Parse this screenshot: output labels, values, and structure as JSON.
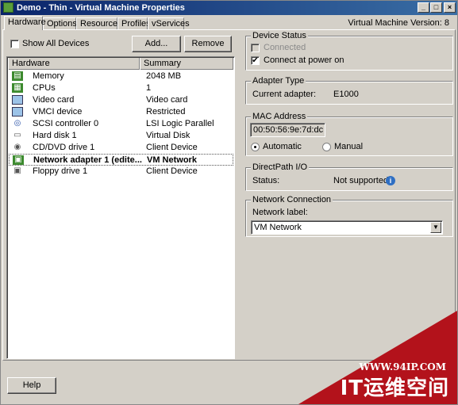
{
  "window": {
    "title": "Demo - Thin - Virtual Machine Properties",
    "vm_version": "Virtual Machine Version: 8",
    "controls": {
      "minimize": "_",
      "maximize": "□",
      "close": "×"
    }
  },
  "tabs": [
    {
      "label": "Hardware"
    },
    {
      "label": "Options"
    },
    {
      "label": "Resources"
    },
    {
      "label": "Profiles"
    },
    {
      "label": "vServices"
    }
  ],
  "hardware": {
    "show_all_devices_label": "Show All Devices",
    "add_button": "Add...",
    "remove_button": "Remove",
    "columns": {
      "hardware": "Hardware",
      "summary": "Summary"
    },
    "rows": [
      {
        "name": "Memory",
        "summary": "2048 MB",
        "icon": "memory-icon"
      },
      {
        "name": "CPUs",
        "summary": "1",
        "icon": "cpu-icon"
      },
      {
        "name": "Video card",
        "summary": "Video card",
        "icon": "video-card-icon"
      },
      {
        "name": "VMCI device",
        "summary": "Restricted",
        "icon": "vmci-icon"
      },
      {
        "name": "SCSI controller 0",
        "summary": "LSI Logic Parallel",
        "icon": "scsi-icon"
      },
      {
        "name": "Hard disk 1",
        "summary": "Virtual Disk",
        "icon": "hard-disk-icon"
      },
      {
        "name": "CD/DVD drive 1",
        "summary": "Client Device",
        "icon": "cd-dvd-icon"
      },
      {
        "name": "Network adapter 1 (edite...",
        "summary": "VM Network",
        "icon": "network-adapter-icon",
        "selected": true
      },
      {
        "name": "Floppy drive 1",
        "summary": "Client Device",
        "icon": "floppy-icon"
      }
    ]
  },
  "device_status": {
    "title": "Device Status",
    "connected_label": "Connected",
    "connect_at_power_on_label": "Connect at power on",
    "connect_at_power_on_checked": "✔"
  },
  "adapter_type": {
    "title": "Adapter Type",
    "current_label": "Current adapter:",
    "current_value": "E1000"
  },
  "mac_address": {
    "title": "MAC Address",
    "value": "00:50:56:9e:7d:dc",
    "automatic_label": "Automatic",
    "manual_label": "Manual"
  },
  "directpath": {
    "title": "DirectPath I/O",
    "status_label": "Status:",
    "status_value": "Not supported",
    "info_glyph": "i"
  },
  "network_connection": {
    "title": "Network Connection",
    "label": "Network label:",
    "selected": "VM Network",
    "arrow_glyph": "▼"
  },
  "footer": {
    "help_button": "Help"
  },
  "watermark": {
    "url": "WWW.94IP.COM",
    "text": "IT运维空间"
  },
  "colors": {
    "titlebar": "#0a246a",
    "dialog": "#d4d0c8",
    "watermark": "#b3121b"
  }
}
